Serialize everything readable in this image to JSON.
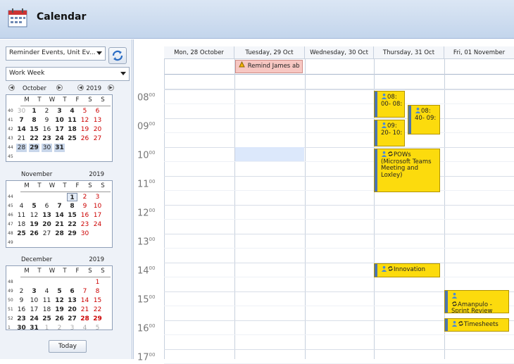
{
  "app": {
    "title": "Calendar"
  },
  "left": {
    "filter_value": "Reminder Events, Unit Ev...",
    "view_value": "Work Week",
    "today_label": "Today",
    "dow": [
      "M",
      "T",
      "W",
      "T",
      "F",
      "S",
      "S"
    ],
    "oct": {
      "month": "October",
      "year": "2019",
      "weeks": [
        "40",
        "41",
        "42",
        "43",
        "44",
        "45"
      ]
    },
    "nov": {
      "month": "November",
      "year": "2019",
      "weeks": [
        "44",
        "45",
        "46",
        "47",
        "48",
        "49"
      ]
    },
    "dec": {
      "month": "December",
      "year": "2019",
      "weeks": [
        "48",
        "49",
        "50",
        "51",
        "52",
        "1"
      ]
    }
  },
  "schedule": {
    "days": [
      "Mon, 28 October",
      "Tuesday, 29 Oct",
      "Wednesday, 30 Oct",
      "Thursday, 31 Oct",
      "Fri, 01 November"
    ],
    "hours": [
      "08",
      "09",
      "10",
      "11",
      "12",
      "13",
      "14",
      "15",
      "16",
      "17"
    ],
    "minute_label": "00",
    "reminder": "Remind James ab",
    "appts": {
      "a1": "08: 00- 08:",
      "a2": "08: 40- 09:",
      "a3": "09: 20- 10:",
      "a4": "POWs (Microsoft Teams Meeting and Loxley)",
      "a5": "Innovation",
      "a6": "Amanpulo - Sprint Review",
      "a7": "Timesheets"
    },
    "colors": {
      "appointment": "#fcdb0d",
      "reminder": "#f7c7c2",
      "selection": "#dce8fb"
    }
  }
}
